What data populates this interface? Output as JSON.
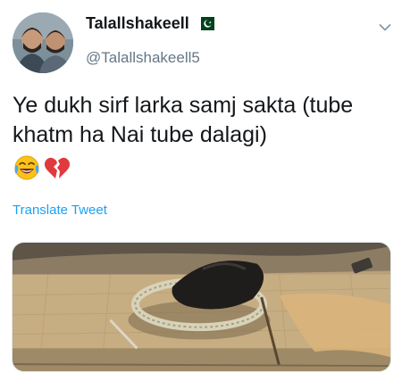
{
  "tweet": {
    "display_name": "Talallshakeell",
    "handle": "@Talallshakeell5",
    "text": "Ye dukh sirf larka samj sakta (tube khatm ha Nai tube dalagi)",
    "emojis": [
      "face-with-tears-of-joy",
      "broken-heart"
    ],
    "translate_label": "Translate Tweet",
    "flag": "pakistan-flag-icon",
    "accent_color": "#1da1f2"
  }
}
